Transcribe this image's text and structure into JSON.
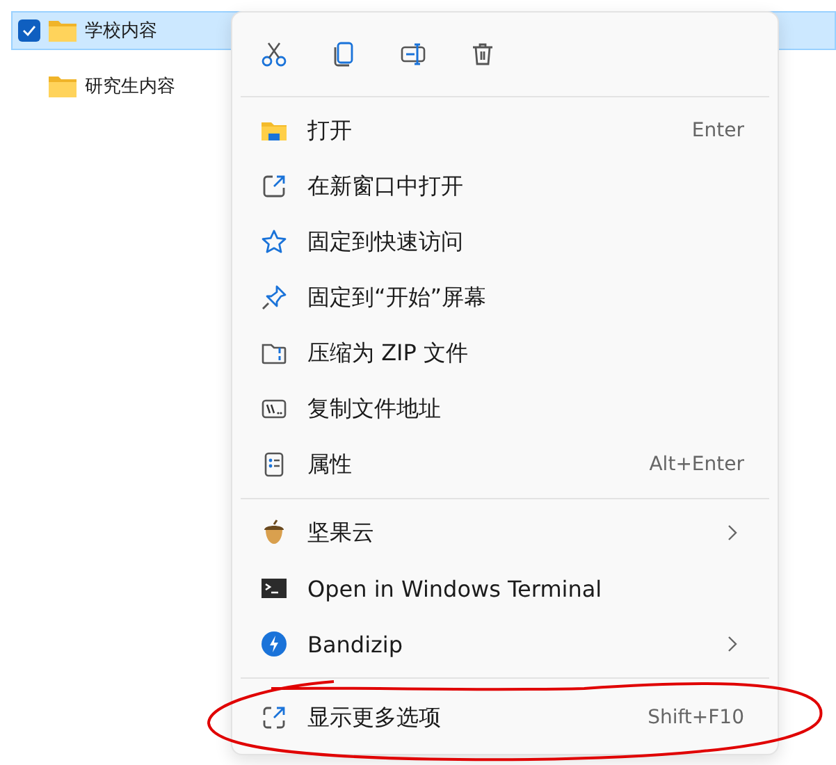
{
  "files": [
    {
      "name": "学校内容",
      "selected": true
    },
    {
      "name": "研究生内容",
      "selected": false
    }
  ],
  "context_menu": {
    "toolbar": [
      {
        "kind": "cut"
      },
      {
        "kind": "copy"
      },
      {
        "kind": "rename"
      },
      {
        "kind": "delete"
      }
    ],
    "sections": [
      {
        "items": [
          {
            "kind": "open",
            "label": "打开",
            "shortcut": "Enter",
            "submenu": false
          },
          {
            "kind": "new-window",
            "label": "在新窗口中打开",
            "submenu": false
          },
          {
            "kind": "star",
            "label": "固定到快速访问",
            "submenu": false
          },
          {
            "kind": "pin",
            "label": "固定到“开始”屏幕",
            "submenu": false
          },
          {
            "kind": "zip",
            "label": "压缩为 ZIP 文件",
            "submenu": false
          },
          {
            "kind": "path",
            "label": "复制文件地址",
            "submenu": false
          },
          {
            "kind": "properties",
            "label": "属性",
            "shortcut": "Alt+Enter",
            "submenu": false
          }
        ]
      },
      {
        "items": [
          {
            "kind": "acorn",
            "label": "坚果云",
            "submenu": true
          },
          {
            "kind": "terminal",
            "label": "Open in Windows Terminal",
            "submenu": false
          },
          {
            "kind": "bandizip",
            "label": "Bandizip",
            "submenu": true
          }
        ]
      },
      {
        "items": [
          {
            "kind": "more",
            "label": "显示更多选项",
            "shortcut": "Shift+F10",
            "submenu": false
          }
        ]
      }
    ]
  }
}
